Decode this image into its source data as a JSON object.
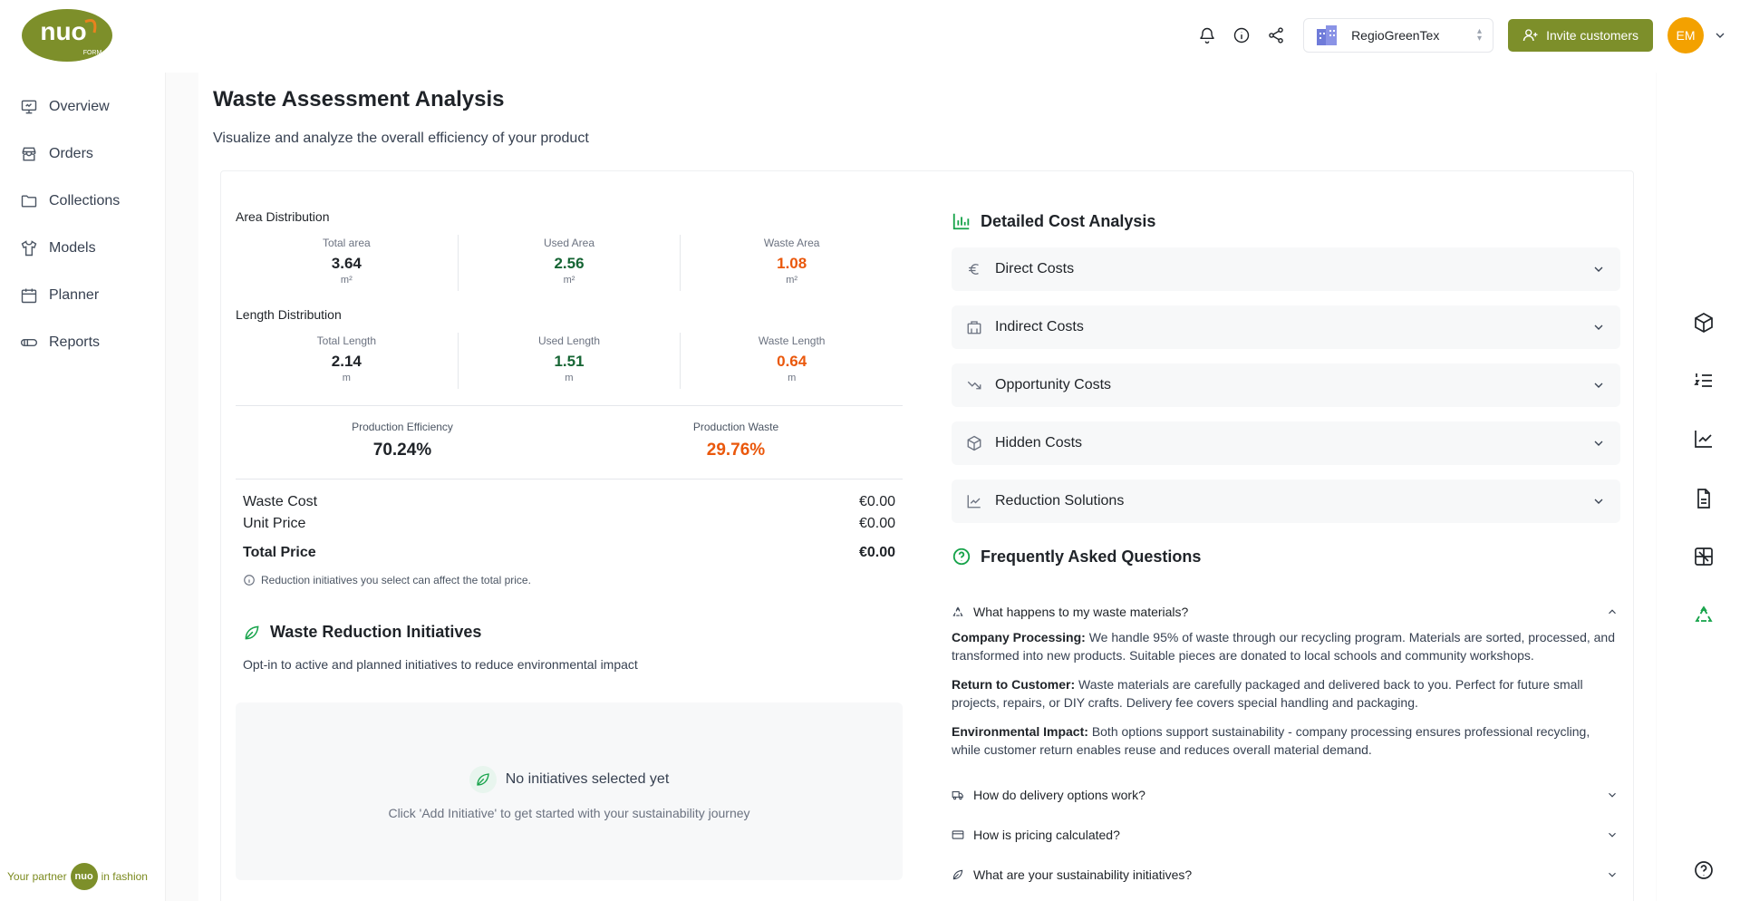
{
  "brand": {
    "logo_text": "nuo",
    "logo_sub": "FORM",
    "partner_prefix": "Your partner",
    "partner_logo": "nuo",
    "partner_suffix": "in fashion",
    "accent": "#7d8f2a"
  },
  "sidebar": {
    "items": [
      {
        "label": "Overview",
        "icon": "monitor-icon"
      },
      {
        "label": "Orders",
        "icon": "store-icon"
      },
      {
        "label": "Collections",
        "icon": "folder-icon"
      },
      {
        "label": "Models",
        "icon": "shirt-icon"
      },
      {
        "label": "Planner",
        "icon": "calendar-icon"
      },
      {
        "label": "Reports",
        "icon": "reports-icon"
      }
    ]
  },
  "header": {
    "org_name": "RegioGreenTex",
    "invite_label": "Invite customers",
    "avatar_initials": "EM"
  },
  "page": {
    "title": "Waste Assessment Analysis",
    "subtitle": "Visualize and analyze the overall efficiency of your product"
  },
  "area": {
    "label": "Area Distribution",
    "stats": [
      {
        "label": "Total area",
        "value": "3.64",
        "unit": "m²"
      },
      {
        "label": "Used Area",
        "value": "2.56",
        "unit": "m²"
      },
      {
        "label": "Waste Area",
        "value": "1.08",
        "unit": "m²"
      }
    ]
  },
  "length": {
    "label": "Length Distribution",
    "stats": [
      {
        "label": "Total Length",
        "value": "2.14",
        "unit": "m"
      },
      {
        "label": "Used Length",
        "value": "1.51",
        "unit": "m"
      },
      {
        "label": "Waste Length",
        "value": "0.64",
        "unit": "m"
      }
    ]
  },
  "efficiency": {
    "eff_label": "Production Efficiency",
    "eff_value": "70.24%",
    "waste_label": "Production Waste",
    "waste_value": "29.76%"
  },
  "pricing": {
    "waste_cost_label": "Waste Cost",
    "waste_cost_value": "€0.00",
    "unit_price_label": "Unit Price",
    "unit_price_value": "€0.00",
    "total_label": "Total Price",
    "total_value": "€0.00",
    "note": "Reduction initiatives you select can affect the total price."
  },
  "initiatives": {
    "title": "Waste Reduction Initiatives",
    "subtitle": "Opt-in to active and planned initiatives to reduce environmental impact",
    "empty_title": "No initiatives selected yet",
    "empty_sub": "Click 'Add Initiative' to get started with your sustainability journey"
  },
  "costs": {
    "title": "Detailed Cost Analysis",
    "items": [
      {
        "label": "Direct Costs",
        "icon": "euro-icon"
      },
      {
        "label": "Indirect Costs",
        "icon": "building-icon"
      },
      {
        "label": "Opportunity Costs",
        "icon": "trending-down-icon"
      },
      {
        "label": "Hidden Costs",
        "icon": "package-icon"
      },
      {
        "label": "Reduction Solutions",
        "icon": "line-chart-icon"
      }
    ]
  },
  "faq": {
    "title": "Frequently Asked Questions",
    "q1": "What happens to my waste materials?",
    "a1_label": "Company Processing:",
    "a1_text": "We handle 95% of waste through our recycling program. Materials are sorted, processed, and transformed into new products. Suitable pieces are donated to local schools and community workshops.",
    "a2_label": "Return to Customer:",
    "a2_text": "Waste materials are carefully packaged and delivered back to you. Perfect for future small projects, repairs, or DIY crafts. Delivery fee covers special handling and packaging.",
    "a3_label": "Environmental Impact:",
    "a3_text": "Both options support sustainability - company processing ensures professional recycling, while customer return enables reuse and reduces overall material demand.",
    "q2": "How do delivery options work?",
    "q3": "How is pricing calculated?",
    "q4": "What are your sustainability initiatives?"
  }
}
